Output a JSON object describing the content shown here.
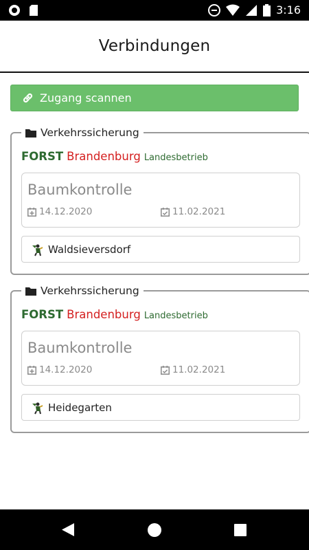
{
  "status_bar": {
    "time": "3:16"
  },
  "header": {
    "title": "Verbindungen"
  },
  "scan_button": {
    "label": "Zugang scannen"
  },
  "cards": [
    {
      "legend": "Verkehrssicherung",
      "org": {
        "forst": "FORST",
        "brand": "Brandenburg",
        "suffix": "Landesbetrieb"
      },
      "inspection": {
        "title": "Baumkontrolle",
        "start_date": "14.12.2020",
        "end_date": "11.02.2021"
      },
      "location": "Waldsieversdorf"
    },
    {
      "legend": "Verkehrssicherung",
      "org": {
        "forst": "FORST",
        "brand": "Brandenburg",
        "suffix": "Landesbetrieb"
      },
      "inspection": {
        "title": "Baumkontrolle",
        "start_date": "14.12.2020",
        "end_date": "11.02.2021"
      },
      "location": "Heidegarten"
    }
  ],
  "colors": {
    "accent_green": "#6bbf6b",
    "forst_green": "#2e6b31",
    "brand_red": "#d42020"
  },
  "icons": [
    "link-icon",
    "folder-icon",
    "calendar-plus-icon",
    "calendar-check-icon",
    "tree-worker-icon"
  ]
}
